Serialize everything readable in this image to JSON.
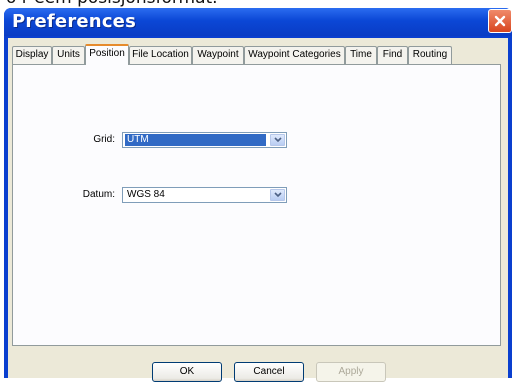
{
  "caption": {
    "text": "o r eem posisjonsformat."
  },
  "window": {
    "title": "Preferences"
  },
  "tabs": [
    {
      "label": "Display"
    },
    {
      "label": "Units"
    },
    {
      "label": "Position"
    },
    {
      "label": "File Location"
    },
    {
      "label": "Waypoint"
    },
    {
      "label": "Waypoint Categories"
    },
    {
      "label": "Time"
    },
    {
      "label": "Find"
    },
    {
      "label": "Routing"
    }
  ],
  "active_tab": "Position",
  "form": {
    "grid": {
      "label": "Grid:",
      "value": "UTM"
    },
    "datum": {
      "label": "Datum:",
      "value": "WGS 84"
    }
  },
  "buttons": {
    "ok": "OK",
    "cancel": "Cancel",
    "apply": "Apply"
  },
  "colors": {
    "title_bar": "#0b47d6",
    "selection": "#316ac5",
    "active_tab_highlight": "#e68b2c",
    "close_button": "#d8451e"
  }
}
